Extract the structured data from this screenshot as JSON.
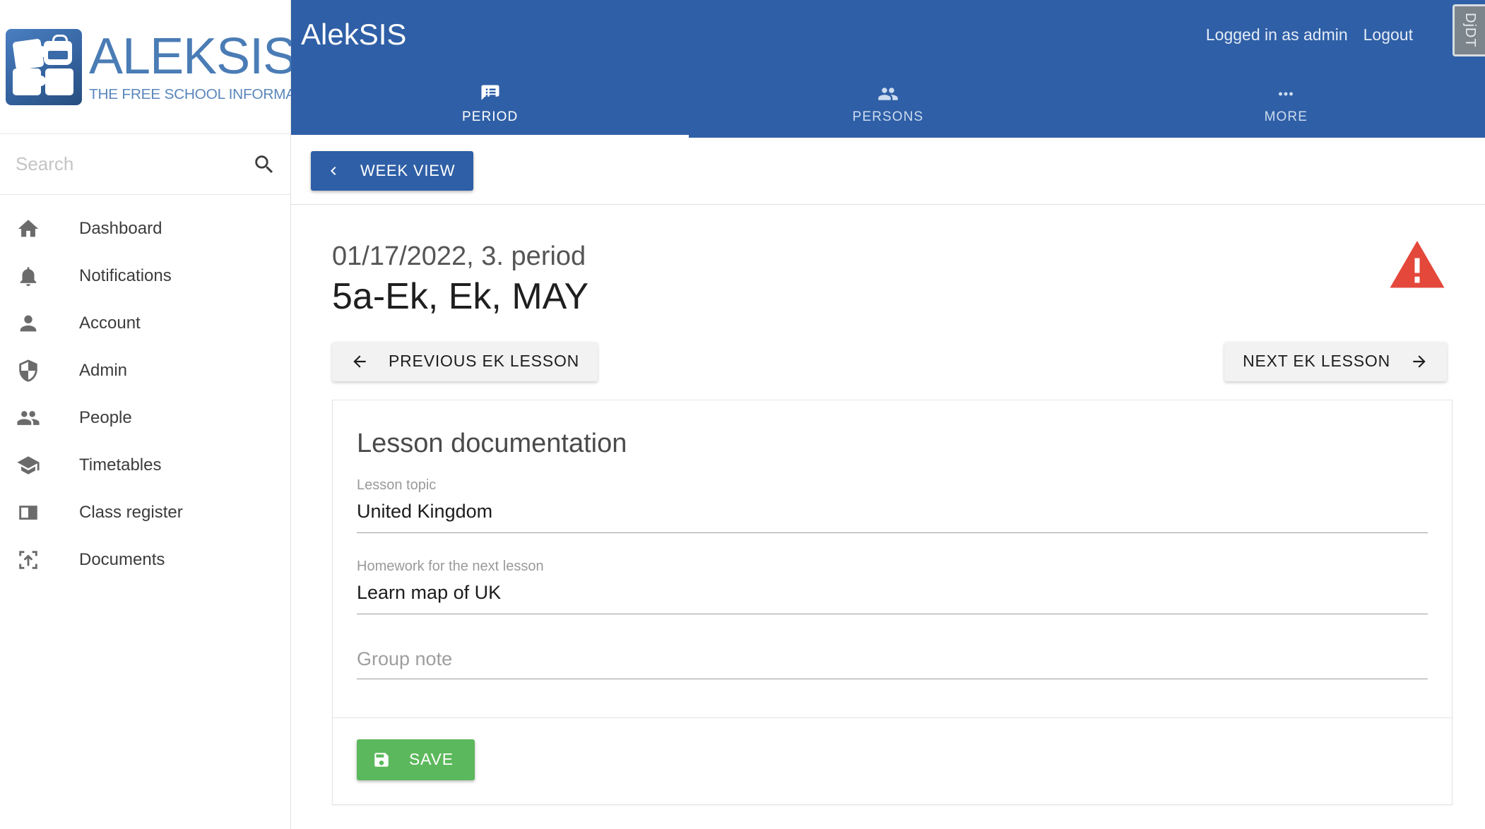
{
  "sidebar": {
    "logo": {
      "title": "ALEKSIS",
      "subtitle": "THE FREE SCHOOL INFORMATION SYSTEM"
    },
    "search": {
      "placeholder": "Search",
      "value": ""
    },
    "items": [
      {
        "label": "Dashboard",
        "icon": "home-icon"
      },
      {
        "label": "Notifications",
        "icon": "bell-icon"
      },
      {
        "label": "Account",
        "icon": "person-icon"
      },
      {
        "label": "Admin",
        "icon": "shield-icon"
      },
      {
        "label": "People",
        "icon": "people-icon"
      },
      {
        "label": "Timetables",
        "icon": "graduation-cap-icon"
      },
      {
        "label": "Class register",
        "icon": "book-icon"
      },
      {
        "label": "Documents",
        "icon": "upload-box-icon"
      }
    ]
  },
  "header": {
    "brand": "AlekSIS",
    "logged_in_as": "Logged in as admin",
    "logout": "Logout",
    "debug_toolbar": "DjDT",
    "accent_color": "#2f5fa6",
    "tabs": [
      {
        "label": "PERIOD",
        "icon": "list-message-icon",
        "active": true
      },
      {
        "label": "PERSONS",
        "icon": "people-icon",
        "active": false
      },
      {
        "label": "MORE",
        "icon": "ellipsis-icon",
        "active": false
      }
    ]
  },
  "subbar": {
    "week_view": "WEEK VIEW"
  },
  "page": {
    "subtitle": "01/17/2022, 3. period",
    "title": "5a-Ek, Ek, MAY",
    "warning_icon": "warning-triangle-icon",
    "warning_color": "#e4483b",
    "previous_lesson": "PREVIOUS EK LESSON",
    "next_lesson": "NEXT EK LESSON"
  },
  "lesson_documentation": {
    "heading": "Lesson documentation",
    "fields": [
      {
        "label": "Lesson topic",
        "value": "United Kingdom",
        "placeholder": ""
      },
      {
        "label": "Homework for the next lesson",
        "value": "Learn map of UK",
        "placeholder": ""
      }
    ],
    "group_note": {
      "label": "Group note",
      "value": "",
      "placeholder": "Group note"
    },
    "save_label": "SAVE",
    "save_color": "#5cb85c"
  }
}
